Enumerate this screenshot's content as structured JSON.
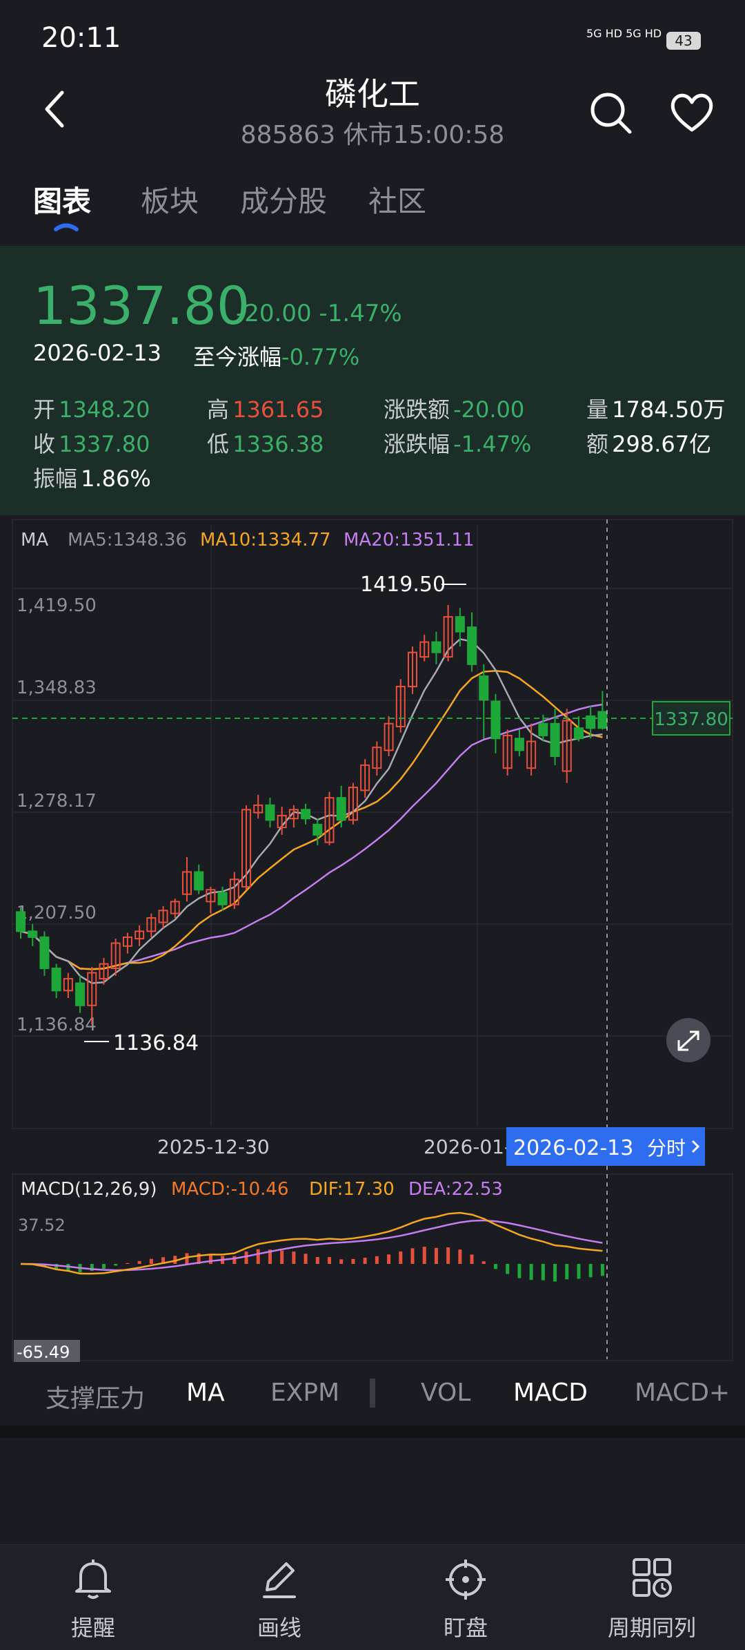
{
  "status": {
    "time": "20:11",
    "signal": "5G HD 5G HD",
    "battery": "43"
  },
  "header": {
    "title": "磷化工",
    "code": "885863",
    "market_status": "休市15:00:58"
  },
  "tabs": [
    "图表",
    "板块",
    "成分股",
    "社区"
  ],
  "quote": {
    "price": "1337.80",
    "change": "-20.00",
    "change_pct": "-1.47%",
    "date": "2026-02-13",
    "since_label": "至今涨幅",
    "since_value": "-0.77%",
    "open_label": "开",
    "open": "1348.20",
    "high_label": "高",
    "high": "1361.65",
    "chg_label": "涨跌额",
    "chg": "-20.00",
    "vol_label": "量",
    "vol": "1784.50万",
    "close_label": "收",
    "close": "1337.80",
    "low_label": "低",
    "low": "1336.38",
    "pct_label": "涨跌幅",
    "pct": "-1.47%",
    "amt_label": "额",
    "amt": "298.67亿",
    "amp_label": "振幅",
    "amp": "1.86%"
  },
  "ma_legend": {
    "label": "MA",
    "ma5": "MA5:1348.36",
    "ma10": "MA10:1334.77",
    "ma20": "MA20:1351.11"
  },
  "colors": {
    "up": "#e8503e",
    "down": "#1fa83a",
    "ma5": "#a8aab3",
    "ma10": "#f5a623",
    "ma20": "#c47ef0",
    "accent": "#2e6cf0"
  },
  "chart_data": {
    "type": "candlestick",
    "y_ticks": [
      "1,419.50",
      "1,348.83",
      "1,278.17",
      "1,207.50",
      "1,136.84"
    ],
    "x_ticks": [
      "2025-12-30",
      "2026-01-"
    ],
    "max_label": "1419.50",
    "min_label": "1136.84",
    "last_price_label": "1337.80",
    "selected_label": "2026-02-13",
    "selected_btn": "分时",
    "candles": [
      [
        1213,
        1200,
        1216,
        1195
      ],
      [
        1200,
        1196,
        1205,
        1190
      ],
      [
        1196,
        1175,
        1200,
        1170
      ],
      [
        1175,
        1160,
        1178,
        1155
      ],
      [
        1160,
        1168,
        1172,
        1155
      ],
      [
        1165,
        1150,
        1170,
        1145
      ],
      [
        1150,
        1172,
        1176,
        1137
      ],
      [
        1168,
        1178,
        1182,
        1164
      ],
      [
        1175,
        1192,
        1195,
        1170
      ],
      [
        1190,
        1196,
        1199,
        1185
      ],
      [
        1195,
        1200,
        1204,
        1190
      ],
      [
        1200,
        1209,
        1212,
        1196
      ],
      [
        1206,
        1214,
        1217,
        1202
      ],
      [
        1212,
        1220,
        1222,
        1209
      ],
      [
        1225,
        1240,
        1250,
        1220
      ],
      [
        1240,
        1228,
        1245,
        1225
      ],
      [
        1220,
        1228,
        1230,
        1212
      ],
      [
        1226,
        1218,
        1230,
        1214
      ],
      [
        1218,
        1235,
        1240,
        1215
      ],
      [
        1230,
        1282,
        1285,
        1228
      ],
      [
        1280,
        1285,
        1292,
        1276
      ],
      [
        1285,
        1275,
        1290,
        1270
      ],
      [
        1270,
        1278,
        1284,
        1265
      ],
      [
        1276,
        1282,
        1285,
        1270
      ],
      [
        1282,
        1276,
        1286,
        1272
      ],
      [
        1272,
        1265,
        1276,
        1258
      ],
      [
        1260,
        1290,
        1294,
        1258
      ],
      [
        1290,
        1275,
        1298,
        1270
      ],
      [
        1275,
        1297,
        1300,
        1272
      ],
      [
        1295,
        1312,
        1316,
        1290
      ],
      [
        1310,
        1324,
        1328,
        1305
      ],
      [
        1322,
        1340,
        1345,
        1318
      ],
      [
        1338,
        1365,
        1370,
        1334
      ],
      [
        1365,
        1388,
        1392,
        1360
      ],
      [
        1385,
        1395,
        1400,
        1382
      ],
      [
        1395,
        1388,
        1402,
        1380
      ],
      [
        1385,
        1412,
        1420,
        1382
      ],
      [
        1412,
        1402,
        1418,
        1392
      ],
      [
        1405,
        1380,
        1415,
        1375
      ],
      [
        1372,
        1356,
        1380,
        1330
      ],
      [
        1355,
        1330,
        1360,
        1320
      ],
      [
        1310,
        1332,
        1336,
        1305
      ],
      [
        1330,
        1322,
        1336,
        1318
      ],
      [
        1310,
        1328,
        1340,
        1305
      ],
      [
        1340,
        1332,
        1346,
        1328
      ],
      [
        1340,
        1318,
        1350,
        1312
      ],
      [
        1308,
        1342,
        1350,
        1300
      ],
      [
        1337,
        1330,
        1345,
        1328
      ],
      [
        1345,
        1337,
        1352,
        1330
      ],
      [
        1348,
        1337,
        1362,
        1336
      ]
    ]
  },
  "macd_legend": {
    "label": "MACD(12,26,9)",
    "macd": "MACD:-10.46",
    "dif": "DIF:17.30",
    "dea": "DEA:22.53",
    "top": "37.52",
    "bottom": "-65.49"
  },
  "indicators": [
    "支撑压力",
    "MA",
    "EXPM",
    "VOL",
    "MACD",
    "MACD+"
  ],
  "nav": [
    "提醒",
    "画线",
    "盯盘",
    "周期同列"
  ]
}
